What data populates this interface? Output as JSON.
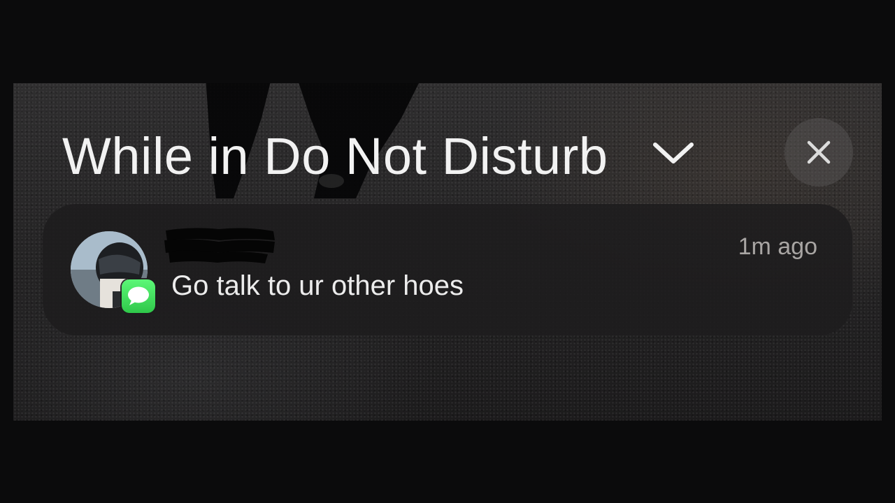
{
  "section": {
    "title": "While in Do Not Disturb",
    "expand_icon": "chevron-down-icon",
    "close_icon": "close-icon"
  },
  "notification": {
    "app_icon": "messages-icon",
    "sender": "",
    "timestamp": "1m ago",
    "message": "Go talk to ur other hoes"
  },
  "colors": {
    "background": "#0b0b0c",
    "notification_bg": "#1e1d1e",
    "badge_green": "#34c759",
    "text_primary": "#f2f2f2",
    "text_secondary": "#a8a5a3"
  }
}
